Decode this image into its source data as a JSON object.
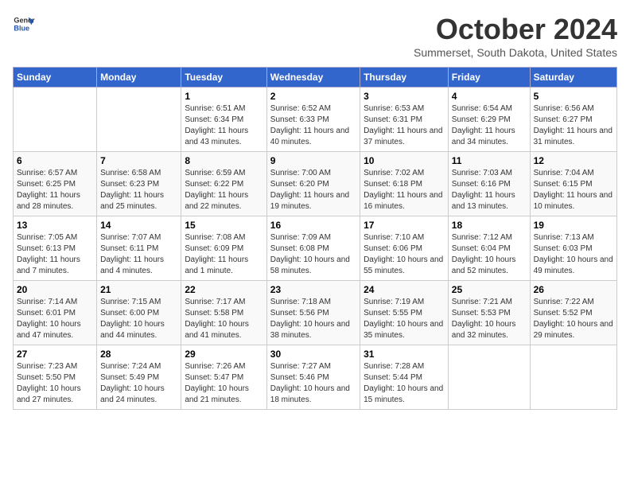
{
  "logo": {
    "line1": "General",
    "line2": "Blue"
  },
  "title": "October 2024",
  "subtitle": "Summerset, South Dakota, United States",
  "days_header": [
    "Sunday",
    "Monday",
    "Tuesday",
    "Wednesday",
    "Thursday",
    "Friday",
    "Saturday"
  ],
  "weeks": [
    [
      {
        "day": "",
        "sunrise": "",
        "sunset": "",
        "daylight": ""
      },
      {
        "day": "",
        "sunrise": "",
        "sunset": "",
        "daylight": ""
      },
      {
        "day": "1",
        "sunrise": "Sunrise: 6:51 AM",
        "sunset": "Sunset: 6:34 PM",
        "daylight": "Daylight: 11 hours and 43 minutes."
      },
      {
        "day": "2",
        "sunrise": "Sunrise: 6:52 AM",
        "sunset": "Sunset: 6:33 PM",
        "daylight": "Daylight: 11 hours and 40 minutes."
      },
      {
        "day": "3",
        "sunrise": "Sunrise: 6:53 AM",
        "sunset": "Sunset: 6:31 PM",
        "daylight": "Daylight: 11 hours and 37 minutes."
      },
      {
        "day": "4",
        "sunrise": "Sunrise: 6:54 AM",
        "sunset": "Sunset: 6:29 PM",
        "daylight": "Daylight: 11 hours and 34 minutes."
      },
      {
        "day": "5",
        "sunrise": "Sunrise: 6:56 AM",
        "sunset": "Sunset: 6:27 PM",
        "daylight": "Daylight: 11 hours and 31 minutes."
      }
    ],
    [
      {
        "day": "6",
        "sunrise": "Sunrise: 6:57 AM",
        "sunset": "Sunset: 6:25 PM",
        "daylight": "Daylight: 11 hours and 28 minutes."
      },
      {
        "day": "7",
        "sunrise": "Sunrise: 6:58 AM",
        "sunset": "Sunset: 6:23 PM",
        "daylight": "Daylight: 11 hours and 25 minutes."
      },
      {
        "day": "8",
        "sunrise": "Sunrise: 6:59 AM",
        "sunset": "Sunset: 6:22 PM",
        "daylight": "Daylight: 11 hours and 22 minutes."
      },
      {
        "day": "9",
        "sunrise": "Sunrise: 7:00 AM",
        "sunset": "Sunset: 6:20 PM",
        "daylight": "Daylight: 11 hours and 19 minutes."
      },
      {
        "day": "10",
        "sunrise": "Sunrise: 7:02 AM",
        "sunset": "Sunset: 6:18 PM",
        "daylight": "Daylight: 11 hours and 16 minutes."
      },
      {
        "day": "11",
        "sunrise": "Sunrise: 7:03 AM",
        "sunset": "Sunset: 6:16 PM",
        "daylight": "Daylight: 11 hours and 13 minutes."
      },
      {
        "day": "12",
        "sunrise": "Sunrise: 7:04 AM",
        "sunset": "Sunset: 6:15 PM",
        "daylight": "Daylight: 11 hours and 10 minutes."
      }
    ],
    [
      {
        "day": "13",
        "sunrise": "Sunrise: 7:05 AM",
        "sunset": "Sunset: 6:13 PM",
        "daylight": "Daylight: 11 hours and 7 minutes."
      },
      {
        "day": "14",
        "sunrise": "Sunrise: 7:07 AM",
        "sunset": "Sunset: 6:11 PM",
        "daylight": "Daylight: 11 hours and 4 minutes."
      },
      {
        "day": "15",
        "sunrise": "Sunrise: 7:08 AM",
        "sunset": "Sunset: 6:09 PM",
        "daylight": "Daylight: 11 hours and 1 minute."
      },
      {
        "day": "16",
        "sunrise": "Sunrise: 7:09 AM",
        "sunset": "Sunset: 6:08 PM",
        "daylight": "Daylight: 10 hours and 58 minutes."
      },
      {
        "day": "17",
        "sunrise": "Sunrise: 7:10 AM",
        "sunset": "Sunset: 6:06 PM",
        "daylight": "Daylight: 10 hours and 55 minutes."
      },
      {
        "day": "18",
        "sunrise": "Sunrise: 7:12 AM",
        "sunset": "Sunset: 6:04 PM",
        "daylight": "Daylight: 10 hours and 52 minutes."
      },
      {
        "day": "19",
        "sunrise": "Sunrise: 7:13 AM",
        "sunset": "Sunset: 6:03 PM",
        "daylight": "Daylight: 10 hours and 49 minutes."
      }
    ],
    [
      {
        "day": "20",
        "sunrise": "Sunrise: 7:14 AM",
        "sunset": "Sunset: 6:01 PM",
        "daylight": "Daylight: 10 hours and 47 minutes."
      },
      {
        "day": "21",
        "sunrise": "Sunrise: 7:15 AM",
        "sunset": "Sunset: 6:00 PM",
        "daylight": "Daylight: 10 hours and 44 minutes."
      },
      {
        "day": "22",
        "sunrise": "Sunrise: 7:17 AM",
        "sunset": "Sunset: 5:58 PM",
        "daylight": "Daylight: 10 hours and 41 minutes."
      },
      {
        "day": "23",
        "sunrise": "Sunrise: 7:18 AM",
        "sunset": "Sunset: 5:56 PM",
        "daylight": "Daylight: 10 hours and 38 minutes."
      },
      {
        "day": "24",
        "sunrise": "Sunrise: 7:19 AM",
        "sunset": "Sunset: 5:55 PM",
        "daylight": "Daylight: 10 hours and 35 minutes."
      },
      {
        "day": "25",
        "sunrise": "Sunrise: 7:21 AM",
        "sunset": "Sunset: 5:53 PM",
        "daylight": "Daylight: 10 hours and 32 minutes."
      },
      {
        "day": "26",
        "sunrise": "Sunrise: 7:22 AM",
        "sunset": "Sunset: 5:52 PM",
        "daylight": "Daylight: 10 hours and 29 minutes."
      }
    ],
    [
      {
        "day": "27",
        "sunrise": "Sunrise: 7:23 AM",
        "sunset": "Sunset: 5:50 PM",
        "daylight": "Daylight: 10 hours and 27 minutes."
      },
      {
        "day": "28",
        "sunrise": "Sunrise: 7:24 AM",
        "sunset": "Sunset: 5:49 PM",
        "daylight": "Daylight: 10 hours and 24 minutes."
      },
      {
        "day": "29",
        "sunrise": "Sunrise: 7:26 AM",
        "sunset": "Sunset: 5:47 PM",
        "daylight": "Daylight: 10 hours and 21 minutes."
      },
      {
        "day": "30",
        "sunrise": "Sunrise: 7:27 AM",
        "sunset": "Sunset: 5:46 PM",
        "daylight": "Daylight: 10 hours and 18 minutes."
      },
      {
        "day": "31",
        "sunrise": "Sunrise: 7:28 AM",
        "sunset": "Sunset: 5:44 PM",
        "daylight": "Daylight: 10 hours and 15 minutes."
      },
      {
        "day": "",
        "sunrise": "",
        "sunset": "",
        "daylight": ""
      },
      {
        "day": "",
        "sunrise": "",
        "sunset": "",
        "daylight": ""
      }
    ]
  ]
}
